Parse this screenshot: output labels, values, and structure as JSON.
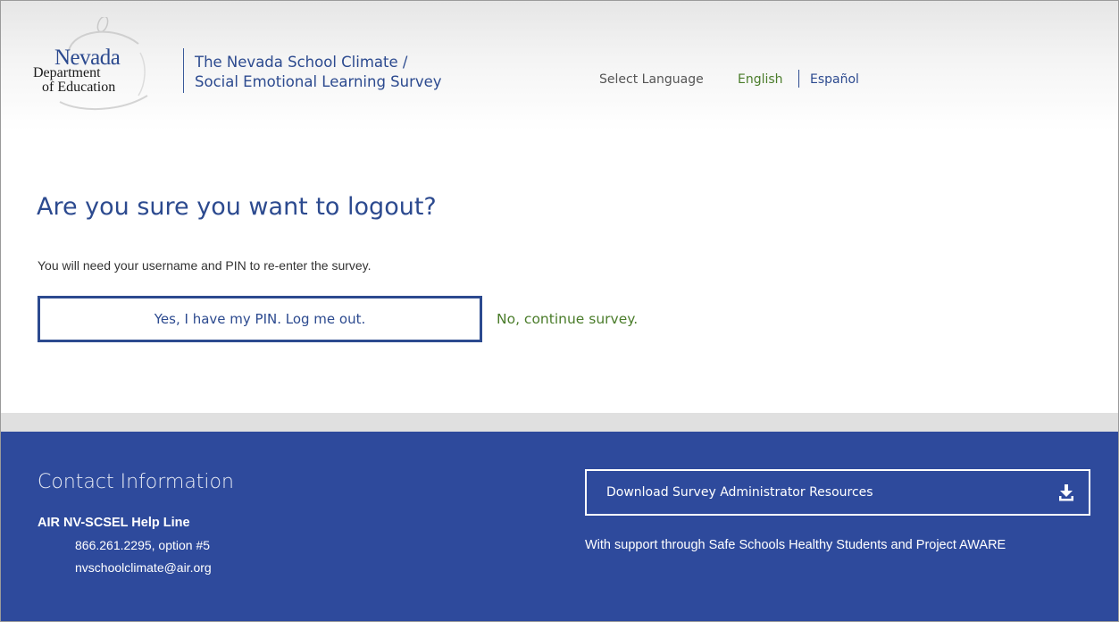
{
  "header": {
    "logo": {
      "nevada": "Nevada",
      "dept_line1": "Department",
      "dept_line2": "of Education"
    },
    "title_line1": "The Nevada School Climate /",
    "title_line2": "Social Emotional Learning Survey",
    "language": {
      "label": "Select Language",
      "english": "English",
      "spanish": "Español"
    }
  },
  "main": {
    "heading": "Are you sure you want to logout?",
    "subtext": "You will need your username and PIN to re-enter the survey.",
    "logout_button": "Yes, I have my PIN. Log me out.",
    "continue_link": "No, continue survey."
  },
  "footer": {
    "contact_title": "Contact Information",
    "helpline": "AIR NV-SCSEL Help Line",
    "phone": "866.261.2295, option #5",
    "email": "nvschoolclimate@air.org",
    "download_button": "Download Survey Administrator Resources",
    "support_text": "With support through Safe Schools Healthy Students and Project AWARE"
  },
  "colors": {
    "brand_blue": "#2e4a9c",
    "link_green": "#4a7c2a",
    "title_blue": "#2c4a8f"
  },
  "icons": {
    "download": "download-icon"
  }
}
